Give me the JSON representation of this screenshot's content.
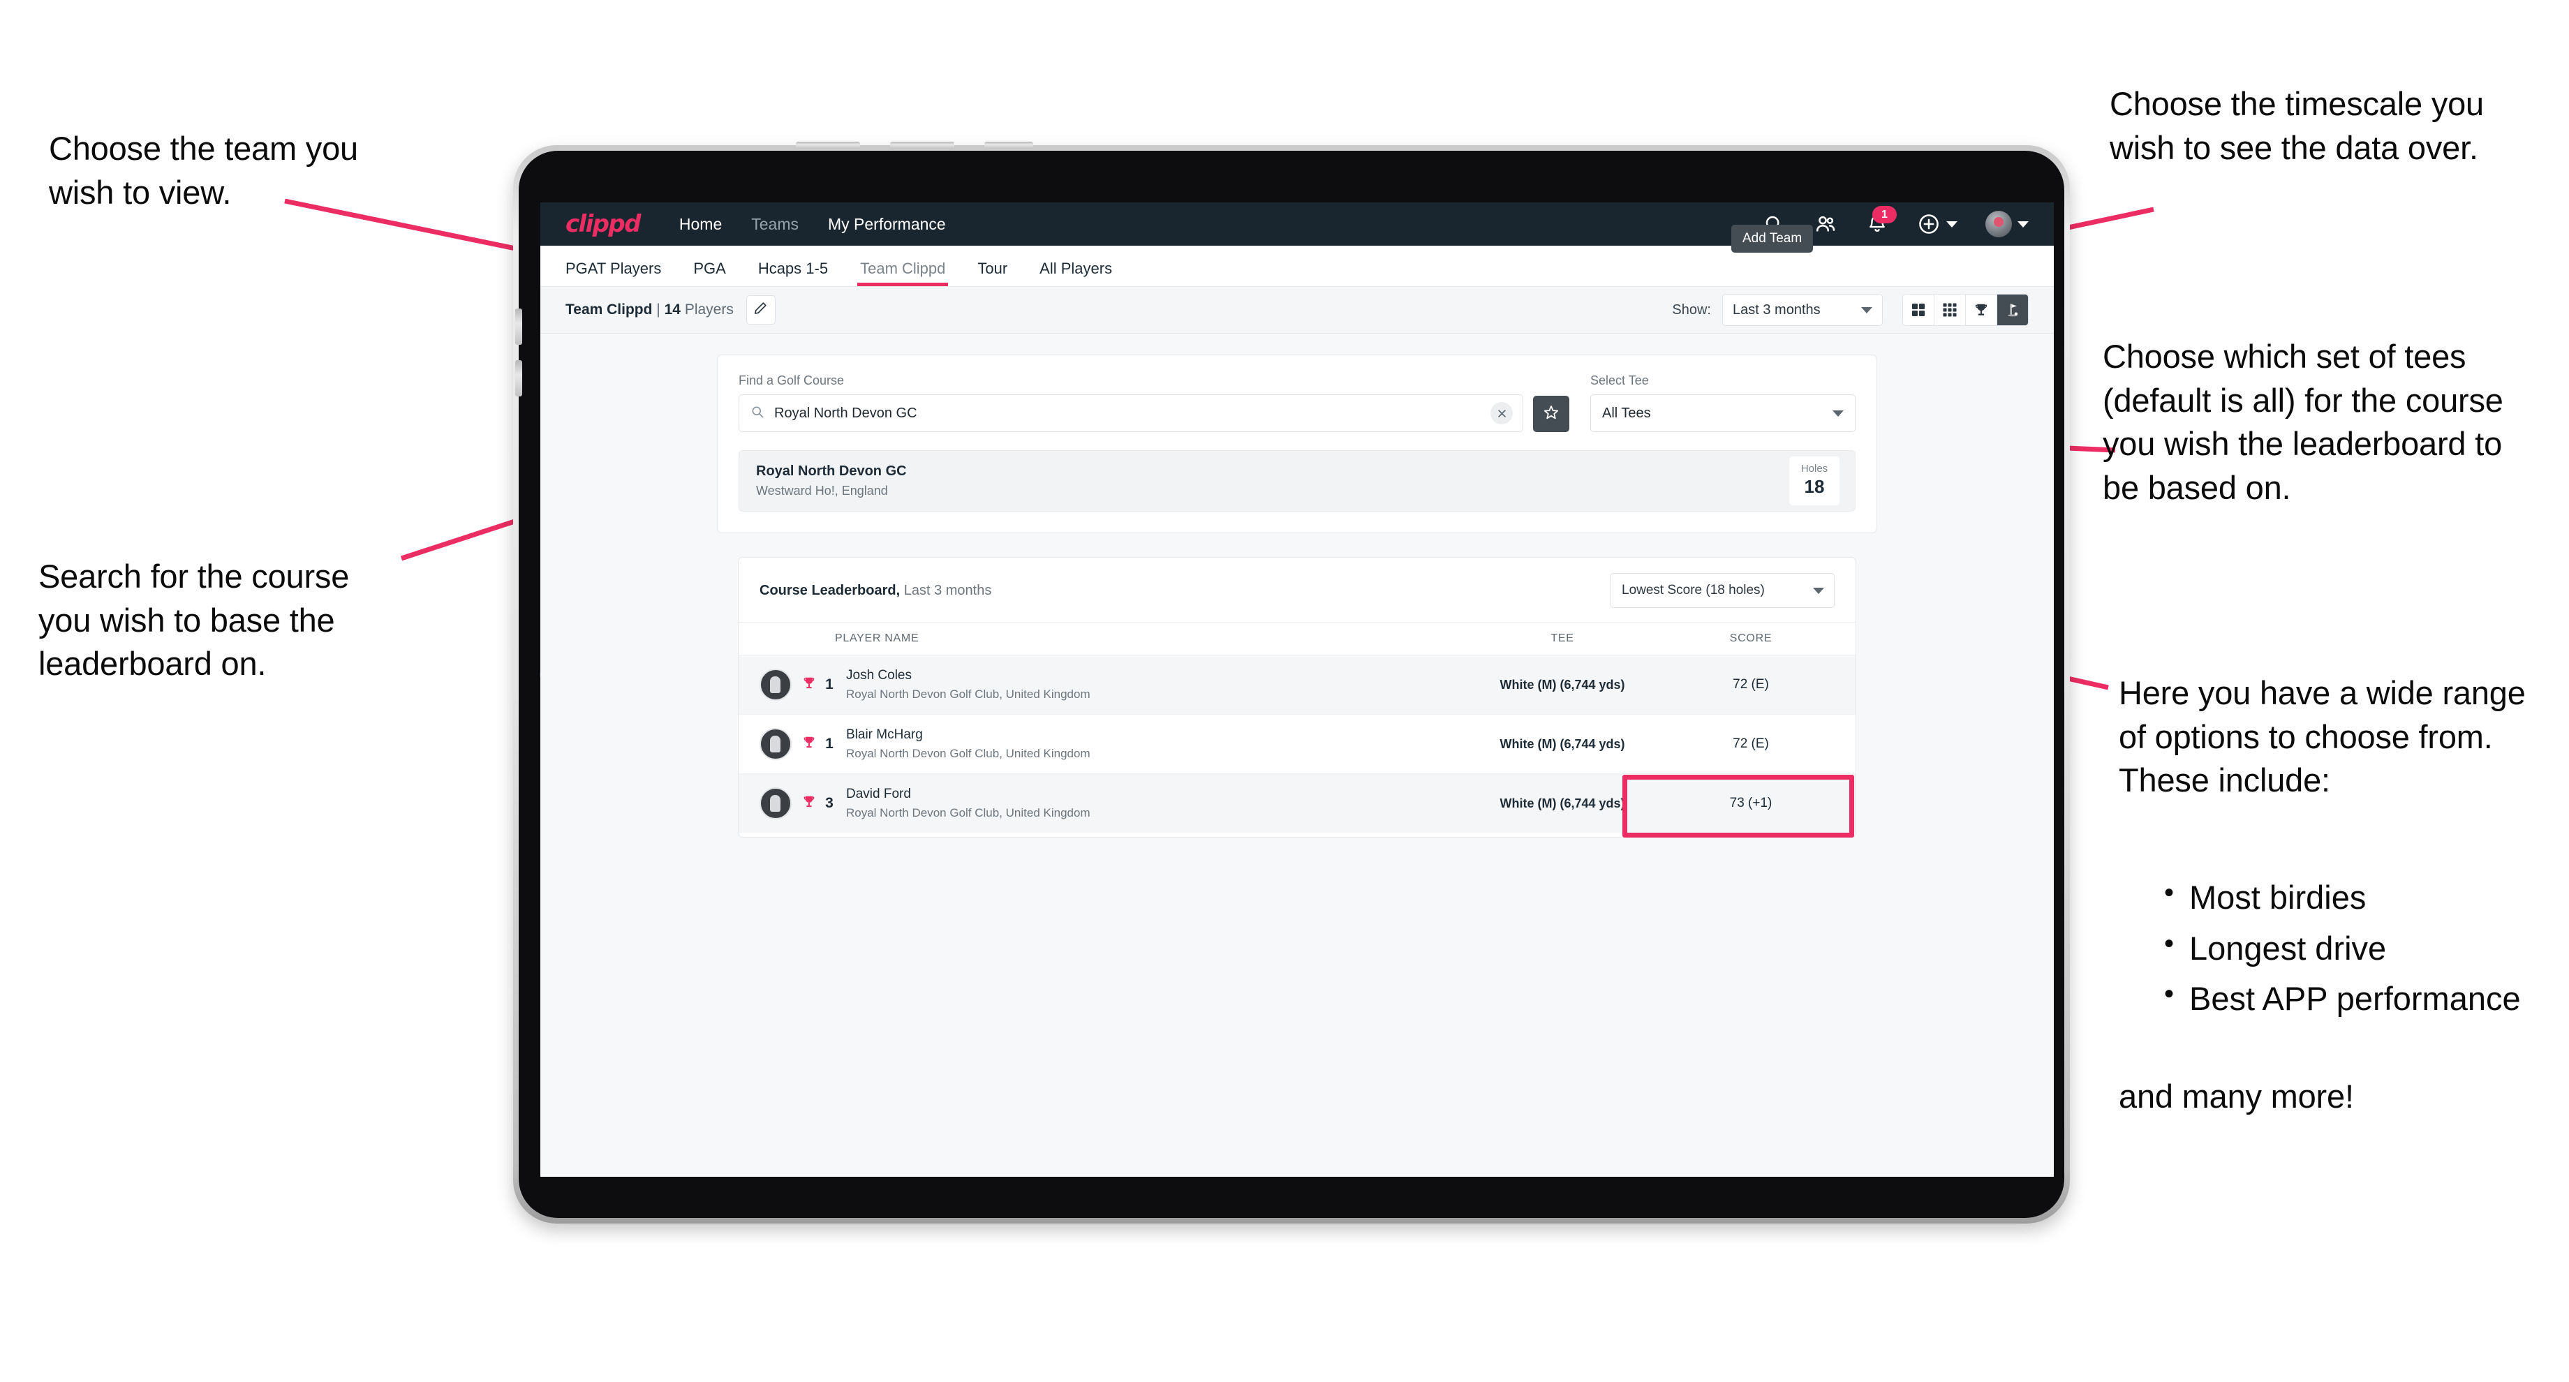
{
  "annotations": {
    "team": "Choose the team you\nwish to view.",
    "timescale": "Choose the timescale you\nwish to see the data over.",
    "tees": "Choose which set of tees\n(default is all) for the course\nyou wish the leaderboard to\nbe based on.",
    "search": "Search for the course\nyou wish to base the\nleaderboard on.",
    "options_intro": "Here you have a wide range\nof options to choose from.\nThese include:",
    "options_list": [
      "Most birdies",
      "Longest drive",
      "Best APP performance"
    ],
    "options_outro": "and many more!"
  },
  "app": {
    "logo": "clippd",
    "nav": [
      {
        "label": "Home",
        "active": true
      },
      {
        "label": "Teams",
        "active": false
      },
      {
        "label": "My Performance",
        "active": true
      }
    ],
    "header_icons": [
      "search-icon",
      "people-icon",
      "bell-icon",
      "plus-icon",
      "avatar"
    ],
    "notification_count": "1",
    "tooltip": "Add Team",
    "tabs": [
      {
        "label": "PGAT Players",
        "state": "normal"
      },
      {
        "label": "PGA",
        "state": "normal"
      },
      {
        "label": "Hcaps 1-5",
        "state": "normal"
      },
      {
        "label": "Team Clippd",
        "state": "active"
      },
      {
        "label": "Tour",
        "state": "normal"
      },
      {
        "label": "All Players",
        "state": "normal"
      }
    ],
    "toolbar": {
      "team_name": "Team Clippd",
      "separator": "|",
      "player_count": "14",
      "players_word": "Players",
      "edit_icon": "pencil-icon",
      "show_label": "Show:",
      "show_value": "Last 3 months",
      "view_buttons": [
        "grid-2x2-icon",
        "grid-3x3-icon",
        "trophy-icon",
        "golf-flag-icon"
      ],
      "view_selected": "golf-flag-icon"
    },
    "search_panel": {
      "course_label": "Find a Golf Course",
      "course_value": "Royal North Devon GC",
      "course_placeholder": "Find a Golf Course",
      "clear_icon": "close-icon",
      "favourite_icon": "star-icon",
      "tee_label": "Select Tee",
      "tee_value": "All Tees"
    },
    "course_result": {
      "name": "Royal North Devon GC",
      "location": "Westward Ho!, England",
      "holes_label": "Holes",
      "holes_value": "18"
    },
    "leaderboard": {
      "title": "Course Leaderboard,",
      "subtitle": "Last 3 months",
      "metric": "Lowest Score (18 holes)",
      "columns": [
        "PLAYER NAME",
        "TEE",
        "SCORE"
      ],
      "rows": [
        {
          "rank": "1",
          "name": "Josh Coles",
          "club": "Royal North Devon Golf Club, United Kingdom",
          "tee": "White (M) (6,744 yds)",
          "score": "72 (E)"
        },
        {
          "rank": "1",
          "name": "Blair McHarg",
          "club": "Royal North Devon Golf Club, United Kingdom",
          "tee": "White (M) (6,744 yds)",
          "score": "72 (E)"
        },
        {
          "rank": "3",
          "name": "David Ford",
          "club": "Royal North Devon Golf Club, United Kingdom",
          "tee": "White (M) (6,744 yds)",
          "score": "73 (+1)"
        }
      ]
    }
  },
  "colors": {
    "accent": "#ec2d63",
    "header_bg": "#19262f",
    "dark_button": "#454d54",
    "page_bg": "#f7f8fa"
  }
}
